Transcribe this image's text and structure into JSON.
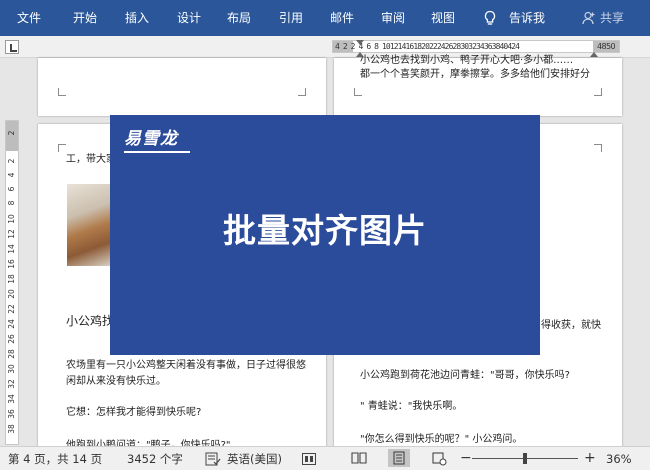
{
  "ribbon": {
    "tabs": [
      "文件",
      "开始",
      "插入",
      "设计",
      "布局",
      "引用",
      "邮件",
      "审阅",
      "视图"
    ],
    "tell_me": "告诉我",
    "share": "共享"
  },
  "ruler": {
    "h_left_label": "4  2",
    "h_numbers": "2  4  6  8 10121416182022242628303234363840424",
    "h_end": "4850",
    "v_numbers": [
      "2",
      "2",
      "4",
      "6",
      "8",
      "10",
      "12",
      "14",
      "16",
      "18",
      "20",
      "22",
      "24",
      "26",
      "28",
      "30",
      "32",
      "34",
      "36",
      "38"
    ]
  },
  "pages": {
    "top_right_line1": "小公鸡也去找到小鸡、鸭子开心大吧·多小都……",
    "top_right_line2": "都一个个喜笑颜开，摩拳擦掌。多多给他们安排好分",
    "left_line1": "工，带大家",
    "left_heading": "小公鸡找",
    "left_p1_l1": "农场里有一只小公鸡整天闲着没有事做，日子过得很悠",
    "left_p1_l2": "闲却从来没有快乐过。",
    "left_p2": "它想：怎样我才能得到快乐呢?",
    "left_p3": "他跑到小鸭问道：\"鸭子，你快乐吗?\"",
    "right_frag": "得收获，就快",
    "right_l1": "小公鸡跑到荷花池边问青蛙：\"哥哥，你快乐吗?",
    "right_l2": "\"  青蛙说：\"我快乐啊。",
    "right_l3": "\"你怎么得到快乐的呢？\"  小公鸡问。"
  },
  "overlay": {
    "brand": "易雪龙",
    "title": "批量对齐图片"
  },
  "status": {
    "page": "第 4 页，共 14 页",
    "words": "3452 个字",
    "language": "英语(美国)",
    "zoom": "36%",
    "zoom_out": "−",
    "zoom_in": "+",
    "zoom_fraction": 0.36
  },
  "colors": {
    "ribbon": "#2b579a",
    "overlay": "#2b4b9b"
  }
}
